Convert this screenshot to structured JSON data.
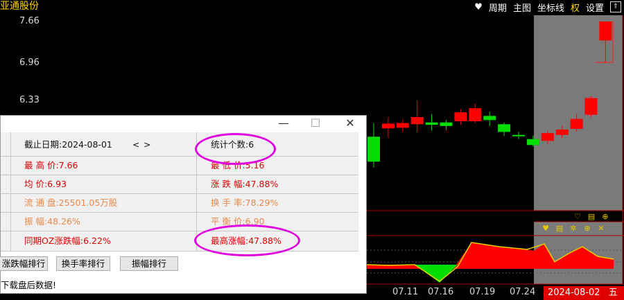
{
  "app": {
    "stock_title": "亚通股份",
    "toolbar": {
      "heart_icon": "heart-icon",
      "period": "周期",
      "main_chart": "主图",
      "axis": "坐标线",
      "quan": "权",
      "settings": "设置",
      "expand": "⇑"
    }
  },
  "chart_data": {
    "type": "candlestick",
    "y_ticks": [
      "7.66",
      "6.96",
      "6.33"
    ],
    "x_labels": [
      "07.11",
      "07.16",
      "07.19",
      "07.24"
    ],
    "selected_date": "2024-08-02",
    "selected_weekday": "五",
    "up_color": "#ff0000",
    "down_color": "#00dd00",
    "candles": [
      {
        "o": 5.72,
        "c": 5.3,
        "h": 5.95,
        "l": 5.2,
        "dir": "down"
      },
      {
        "o": 5.86,
        "c": 5.94,
        "h": 6.05,
        "l": 5.7,
        "dir": "up"
      },
      {
        "o": 5.87,
        "c": 5.95,
        "h": 6.01,
        "l": 5.8,
        "dir": "up"
      },
      {
        "o": 6.05,
        "c": 5.93,
        "h": 6.33,
        "l": 5.8,
        "dir": "up"
      },
      {
        "o": 5.96,
        "c": 5.92,
        "h": 6.1,
        "l": 5.82,
        "dir": "down"
      },
      {
        "o": 5.96,
        "c": 5.9,
        "h": 6.0,
        "l": 5.83,
        "dir": "down"
      },
      {
        "o": 5.98,
        "c": 6.13,
        "h": 6.18,
        "l": 5.92,
        "dir": "up"
      },
      {
        "o": 5.98,
        "c": 6.2,
        "h": 6.27,
        "l": 5.95,
        "dir": "up"
      },
      {
        "o": 6.07,
        "c": 6.0,
        "h": 6.14,
        "l": 5.9,
        "dir": "down"
      },
      {
        "o": 5.93,
        "c": 5.8,
        "h": 5.96,
        "l": 5.73,
        "dir": "down"
      },
      {
        "o": 5.75,
        "c": 5.73,
        "h": 5.8,
        "l": 5.68,
        "dir": "down"
      },
      {
        "o": 5.68,
        "c": 5.58,
        "h": 5.74,
        "l": 5.55,
        "dir": "down"
      },
      {
        "o": 5.65,
        "c": 5.78,
        "h": 5.82,
        "l": 5.6,
        "dir": "up"
      },
      {
        "o": 5.75,
        "c": 5.84,
        "h": 5.9,
        "l": 5.7,
        "dir": "up"
      },
      {
        "o": 5.85,
        "c": 6.02,
        "h": 6.1,
        "l": 5.8,
        "dir": "up"
      },
      {
        "o": 6.09,
        "c": 6.37,
        "h": 6.4,
        "l": 6.05,
        "dir": "up"
      },
      {
        "o": 7.34,
        "c": 7.66,
        "h": 7.66,
        "l": 6.96,
        "dir": "up"
      }
    ]
  },
  "dialog": {
    "minimize": "—",
    "maximize": "☐",
    "close": "✕",
    "end_date": "截止日期:2024-08-01",
    "nav_prev": "<",
    "nav_next": ">",
    "count": "统计个数:6",
    "high": "最 高 价:7.66",
    "low": "最 低 价:5.16",
    "avg": "均    价:6.93",
    "change": "涨 跌 幅:47.88%",
    "float_cap": "流 通 盘:25501.05万股",
    "turnover": "换 手 率:78.29%",
    "amplitude": "振    幅:48.26%",
    "balance": "平 衡 价:6.90",
    "same_period": "同期OZ涨跌幅:6.22%",
    "max_rise": "最高涨幅:47.88%",
    "btn_change_rank": "涨跌幅排行",
    "btn_turnover_rank": "换手率排行",
    "btn_amplitude_rank": "振幅排行",
    "footer_note": "下载盘后数据!"
  }
}
